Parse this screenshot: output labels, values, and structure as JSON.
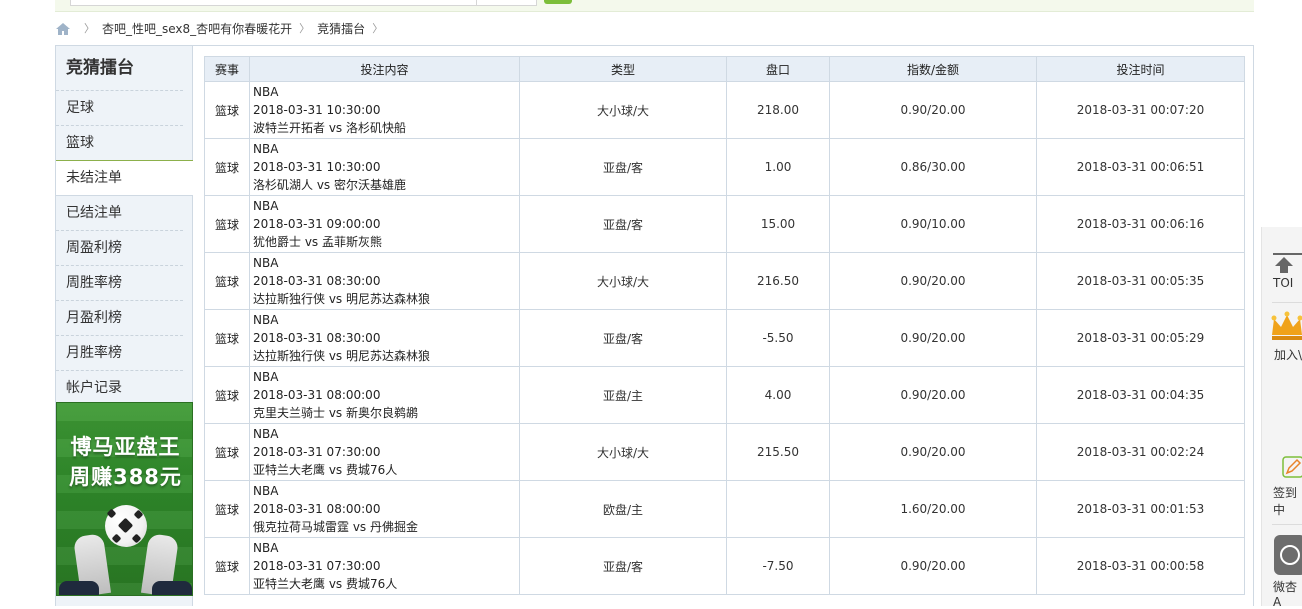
{
  "breadcrumb": {
    "items": [
      "杏吧_性吧_sex8_杏吧有你春暖花开",
      "竞猜擂台"
    ]
  },
  "sidebar": {
    "title": "竞猜擂台",
    "items": [
      "足球",
      "篮球",
      "未结注单",
      "已结注单",
      "周盈利榜",
      "周胜率榜",
      "月盈利榜",
      "月胜率榜",
      "帐户记录"
    ],
    "active_index": 2
  },
  "ad": {
    "line1": "博马亚盘王",
    "line2": "周赚388元"
  },
  "table": {
    "headers": [
      "赛事",
      "投注内容",
      "类型",
      "盘口",
      "指数/金额",
      "投注时间"
    ],
    "rows": [
      {
        "sport": "篮球",
        "league": "NBA",
        "time": "2018-03-31 10:30:00",
        "match": "波特兰开拓者 vs 洛杉矶快船",
        "type": "大小球/大",
        "line": "218.00",
        "odds": "0.90/20.00",
        "bet_time": "2018-03-31 00:07:20"
      },
      {
        "sport": "篮球",
        "league": "NBA",
        "time": "2018-03-31 10:30:00",
        "match": "洛杉矶湖人 vs 密尔沃基雄鹿",
        "type": "亚盘/客",
        "line": "1.00",
        "odds": "0.86/30.00",
        "bet_time": "2018-03-31 00:06:51"
      },
      {
        "sport": "篮球",
        "league": "NBA",
        "time": "2018-03-31 09:00:00",
        "match": "犹他爵士 vs 孟菲斯灰熊",
        "type": "亚盘/客",
        "line": "15.00",
        "odds": "0.90/10.00",
        "bet_time": "2018-03-31 00:06:16"
      },
      {
        "sport": "篮球",
        "league": "NBA",
        "time": "2018-03-31 08:30:00",
        "match": "达拉斯独行侠 vs 明尼苏达森林狼",
        "type": "大小球/大",
        "line": "216.50",
        "odds": "0.90/20.00",
        "bet_time": "2018-03-31 00:05:35"
      },
      {
        "sport": "篮球",
        "league": "NBA",
        "time": "2018-03-31 08:30:00",
        "match": "达拉斯独行侠 vs 明尼苏达森林狼",
        "type": "亚盘/客",
        "line": "-5.50",
        "odds": "0.90/20.00",
        "bet_time": "2018-03-31 00:05:29"
      },
      {
        "sport": "篮球",
        "league": "NBA",
        "time": "2018-03-31 08:00:00",
        "match": "克里夫兰骑士 vs 新奥尔良鹈鹕",
        "type": "亚盘/主",
        "line": "4.00",
        "odds": "0.90/20.00",
        "bet_time": "2018-03-31 00:04:35"
      },
      {
        "sport": "篮球",
        "league": "NBA",
        "time": "2018-03-31 07:30:00",
        "match": "亚特兰大老鹰 vs 费城76人",
        "type": "大小球/大",
        "line": "215.50",
        "odds": "0.90/20.00",
        "bet_time": "2018-03-31 00:02:24"
      },
      {
        "sport": "篮球",
        "league": "NBA",
        "time": "2018-03-31 08:00:00",
        "match": "俄克拉荷马城雷霆 vs 丹佛掘金",
        "type": "欧盘/主",
        "line": "",
        "odds": "1.60/20.00",
        "bet_time": "2018-03-31 00:01:53"
      },
      {
        "sport": "篮球",
        "league": "NBA",
        "time": "2018-03-31 07:30:00",
        "match": "亚特兰大老鹰 vs 费城76人",
        "type": "亚盘/客",
        "line": "-7.50",
        "odds": "0.90/20.00",
        "bet_time": "2018-03-31 00:00:58"
      }
    ]
  },
  "right_bar": {
    "top_label": "TOI",
    "vip_label": "加入\\",
    "sign_label": "签到中",
    "app_label": "微杏A"
  },
  "colors": {
    "header_bg": "#e7eef6",
    "sidebar_bg": "#eef3f8",
    "border": "#cfd9e3",
    "active_accent": "#8cb04b",
    "search_button": "#7cbe3a"
  }
}
